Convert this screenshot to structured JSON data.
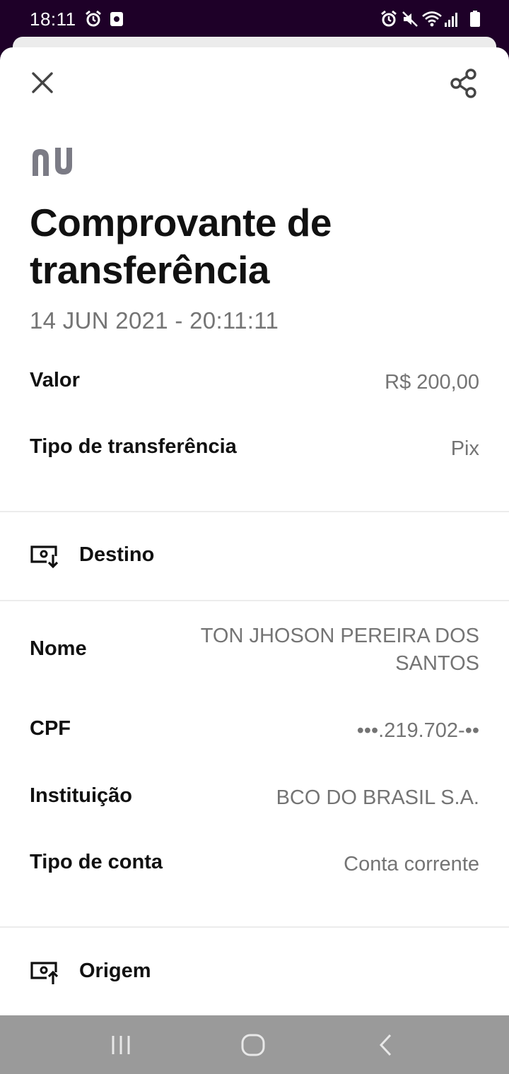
{
  "status_bar": {
    "time": "18:11",
    "left_icons": [
      "alarm-icon",
      "screen-record-icon"
    ],
    "right_icons": [
      "alarm-icon",
      "mute-icon",
      "wifi-icon",
      "signal-icon",
      "battery-icon"
    ]
  },
  "header": {
    "close_icon": "close-icon",
    "share_icon": "share-icon"
  },
  "brand": {
    "logo_text": "nu",
    "color": "#7b7b85"
  },
  "receipt": {
    "title": "Comprovante de transferência",
    "datetime": "14 JUN 2021 - 20:11:11",
    "rows": [
      {
        "label": "Valor",
        "value": "R$ 200,00"
      },
      {
        "label": "Tipo de transferência",
        "value": "Pix"
      }
    ]
  },
  "destino": {
    "title": "Destino",
    "icon": "incoming-money-icon",
    "rows": [
      {
        "label": "Nome",
        "value": "TON JHOSON PEREIRA DOS SANTOS"
      },
      {
        "label": "CPF",
        "value": "•••.219.702-••"
      },
      {
        "label": "Instituição",
        "value": "BCO DO BRASIL S.A."
      },
      {
        "label": "Tipo de conta",
        "value": "Conta corrente"
      }
    ]
  },
  "origem": {
    "title": "Origem",
    "icon": "outgoing-money-icon"
  },
  "nav_bar": {
    "buttons": [
      "recents-icon",
      "home-icon",
      "back-icon"
    ],
    "background": "#9a9a9a"
  },
  "colors": {
    "status_bar": "#1e0028",
    "text_primary": "#111111",
    "text_secondary": "#747474",
    "divider": "#ececec"
  }
}
